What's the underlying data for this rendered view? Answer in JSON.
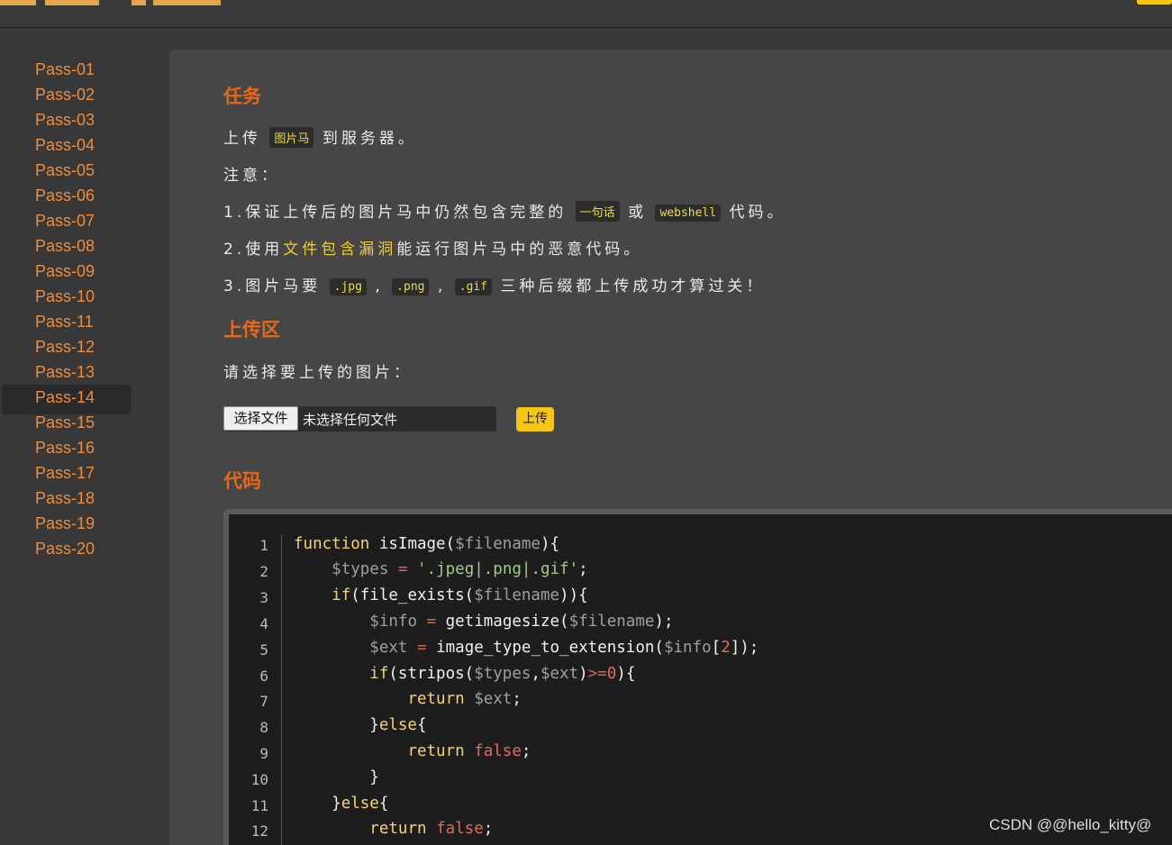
{
  "sidebar": {
    "items": [
      {
        "label": "Pass-01"
      },
      {
        "label": "Pass-02"
      },
      {
        "label": "Pass-03"
      },
      {
        "label": "Pass-04"
      },
      {
        "label": "Pass-05"
      },
      {
        "label": "Pass-06"
      },
      {
        "label": "Pass-07"
      },
      {
        "label": "Pass-08"
      },
      {
        "label": "Pass-09"
      },
      {
        "label": "Pass-10"
      },
      {
        "label": "Pass-11"
      },
      {
        "label": "Pass-12"
      },
      {
        "label": "Pass-13"
      },
      {
        "label": "Pass-14"
      },
      {
        "label": "Pass-15"
      },
      {
        "label": "Pass-16"
      },
      {
        "label": "Pass-17"
      },
      {
        "label": "Pass-18"
      },
      {
        "label": "Pass-19"
      },
      {
        "label": "Pass-20"
      }
    ],
    "active": "Pass-14"
  },
  "task": {
    "heading": "任务",
    "line1_pre": "上传",
    "line1_tag": "图片马",
    "line1_post": "到服务器。",
    "note": "注意：",
    "item1_pre": "1.保证上传后的图片马中仍然包含完整的",
    "item1_tag1": "一句话",
    "item1_mid": "或",
    "item1_tag2": "webshell",
    "item1_post": "代码。",
    "item2_pre": "2.使用",
    "item2_hl": "文件包含漏洞",
    "item2_post": "能运行图片马中的恶意代码。",
    "item3_pre": "3.图片马要",
    "item3_tag1": ".jpg",
    "item3_sep1": ",",
    "item3_tag2": ".png",
    "item3_sep2": ",",
    "item3_tag3": ".gif",
    "item3_post": "三种后缀都上传成功才算过关！"
  },
  "upload": {
    "heading": "上传区",
    "prompt": "请选择要上传的图片：",
    "choose_button": "选择文件",
    "no_file": "未选择任何文件",
    "submit": "上传"
  },
  "code": {
    "heading": "代码",
    "line_numbers": [
      "1",
      "2",
      "3",
      "4",
      "5",
      "6",
      "7",
      "8",
      "9",
      "10",
      "11",
      "12"
    ]
  },
  "watermark": "CSDN @@hello_kitty@",
  "colors": {
    "accent": "#e8671a",
    "link": "#f08c3c",
    "highlight": "#f5c518",
    "panel": "#464646",
    "code_bg": "#1d1d1d"
  }
}
